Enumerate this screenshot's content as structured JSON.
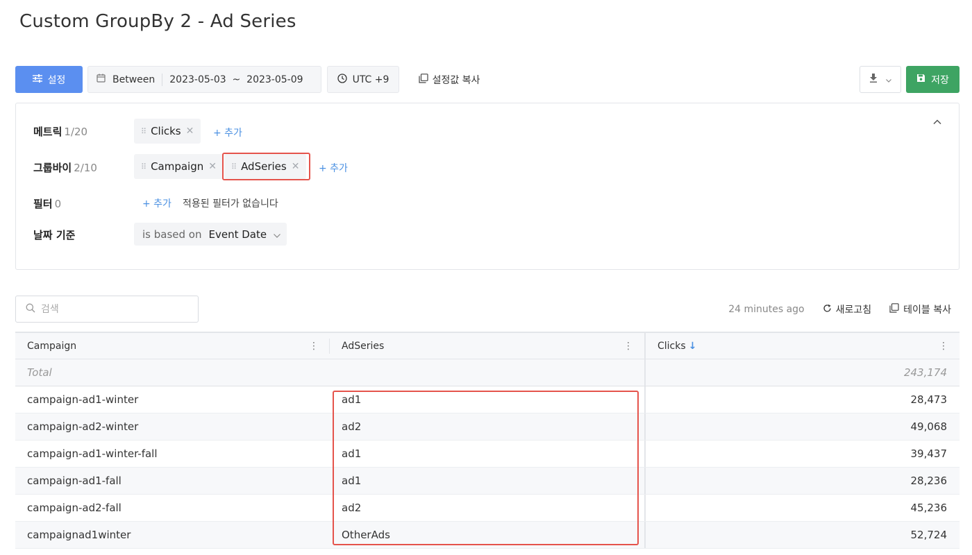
{
  "page": {
    "title": "Custom GroupBy 2 - Ad Series"
  },
  "toolbar": {
    "settings_label": "설정",
    "date_mode": "Between",
    "date_range": "2023-05-03  ~  2023-05-09",
    "timezone": "UTC +9",
    "copy_settings_label": "설정값 복사",
    "save_label": "저장"
  },
  "config": {
    "metrics": {
      "label": "메트릭",
      "count": "1/20",
      "chips": [
        "Clicks"
      ],
      "add_label": "+ 추가"
    },
    "groupby": {
      "label": "그룹바이",
      "count": "2/10",
      "chips": [
        "Campaign",
        "AdSeries"
      ],
      "add_label": "+ 추가"
    },
    "filter": {
      "label": "필터",
      "count": "0",
      "add_label": "+ 추가",
      "empty_text": "적용된 필터가 없습니다"
    },
    "date_basis": {
      "label": "날짜 기준",
      "prefix": "is based on",
      "value": "Event Date"
    }
  },
  "search": {
    "placeholder": "검색"
  },
  "table_actions": {
    "timestamp": "24 minutes ago",
    "refresh_label": "새로고침",
    "copy_table_label": "테이블 복사"
  },
  "table": {
    "columns": [
      "Campaign",
      "AdSeries",
      "Clicks"
    ],
    "sort_indicator": "↓",
    "total": {
      "label": "Total",
      "clicks": "243,174"
    },
    "rows": [
      {
        "campaign": "campaign-ad1-winter",
        "adseries": "ad1",
        "clicks": "28,473"
      },
      {
        "campaign": "campaign-ad2-winter",
        "adseries": "ad2",
        "clicks": "49,068"
      },
      {
        "campaign": "campaign-ad1-winter-fall",
        "adseries": "ad1",
        "clicks": "39,437"
      },
      {
        "campaign": "campaign-ad1-fall",
        "adseries": "ad1",
        "clicks": "28,236"
      },
      {
        "campaign": "campaign-ad2-fall",
        "adseries": "ad2",
        "clicks": "45,236"
      },
      {
        "campaign": "campaignad1winter",
        "adseries": "OtherAds",
        "clicks": "52,724"
      }
    ]
  },
  "colors": {
    "primary": "#5b8ff0",
    "save": "#3ea463",
    "link": "#4a90e2",
    "highlight": "#e5534b"
  }
}
